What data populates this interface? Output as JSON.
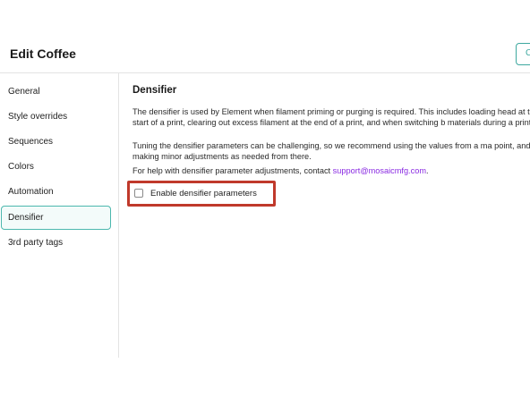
{
  "header": {
    "title": "Edit Coffee",
    "action_button_label": "C"
  },
  "sidebar": {
    "items": [
      {
        "label": "General"
      },
      {
        "label": "Style overrides"
      },
      {
        "label": "Sequences"
      },
      {
        "label": "Colors"
      },
      {
        "label": "Automation"
      },
      {
        "label": "Densifier",
        "active": true
      },
      {
        "label": "3rd party tags"
      }
    ]
  },
  "main": {
    "section_title": "Densifier",
    "paragraph_1": "The densifier is used by Element when filament priming or purging is required. This includes loading head at the start of a print, clearing out excess filament at the end of a print, and when switching b materials during a print.",
    "paragraph_2": "Tuning the densifier parameters can be challenging, so we recommend using the values from a ma point, and making minor adjustments as needed from there.",
    "paragraph_3_prefix": "For help with densifier parameter adjustments, contact ",
    "support_email": "support@mosaicmfg.com",
    "paragraph_3_suffix": ".",
    "checkbox_label": "Enable densifier parameters",
    "checkbox_checked": false
  },
  "colors": {
    "accent": "#3ea89f",
    "highlight": "#c0392b",
    "link": "#8a2be2"
  },
  "icons": {
    "checkbox": "checkbox-unchecked-icon"
  }
}
